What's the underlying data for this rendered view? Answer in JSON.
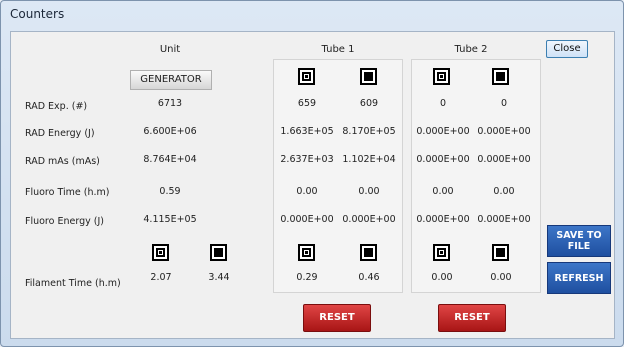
{
  "window": {
    "title": "Counters",
    "close_label": "Close"
  },
  "columns": {
    "unit": "Unit",
    "tube1": "Tube 1",
    "tube2": "Tube 2"
  },
  "generator_label": "GENERATOR",
  "rows": [
    {
      "label": "RAD Exp. (#)",
      "unit": "6713",
      "t1a": "659",
      "t1b": "609",
      "t2a": "0",
      "t2b": "0"
    },
    {
      "label": "RAD Energy (J)",
      "unit": "6.600E+06",
      "t1a": "1.663E+05",
      "t1b": "8.170E+05",
      "t2a": "0.000E+00",
      "t2b": "0.000E+00"
    },
    {
      "label": "RAD mAs (mAs)",
      "unit": "8.764E+04",
      "t1a": "2.637E+03",
      "t1b": "1.102E+04",
      "t2a": "0.000E+00",
      "t2b": "0.000E+00"
    },
    {
      "label": "Fluoro Time (h.m)",
      "unit": "0.59",
      "t1a": "0.00",
      "t1b": "0.00",
      "t2a": "0.00",
      "t2b": "0.00"
    },
    {
      "label": "Fluoro Energy (J)",
      "unit": "4.115E+05",
      "t1a": "0.000E+00",
      "t1b": "0.000E+00",
      "t2a": "0.000E+00",
      "t2b": "0.000E+00"
    }
  ],
  "filament": {
    "label": "Filament Time (h.m)",
    "unit_a": "2.07",
    "unit_b": "3.44",
    "t1a": "0.29",
    "t1b": "0.46",
    "t2a": "0.00",
    "t2b": "0.00"
  },
  "buttons": {
    "save": "SAVE TO FILE",
    "refresh": "REFRESH",
    "reset": "RESET"
  },
  "icons": {
    "large_focus": "large-focus-icon",
    "small_focus": "small-focus-icon"
  }
}
